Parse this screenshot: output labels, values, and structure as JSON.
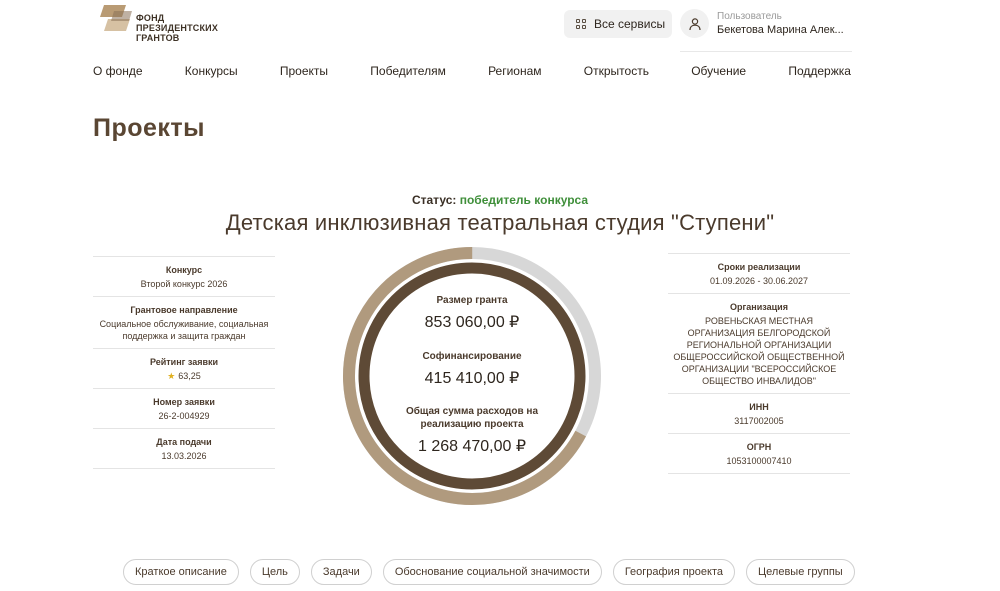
{
  "logo": {
    "line1": "ФОНД",
    "line2": "ПРЕЗИДЕНТСКИХ",
    "line3": "ГРАНТОВ"
  },
  "header": {
    "services_label": "Все сервисы",
    "user_role": "Пользователь",
    "user_name": "Бекетова Марина Алек..."
  },
  "nav": [
    "О фонде",
    "Конкурсы",
    "Проекты",
    "Победителям",
    "Регионам",
    "Открытость",
    "Обучение",
    "Поддержка"
  ],
  "page_title": "Проекты",
  "status": {
    "label": "Статус:",
    "value": "победитель конкурса"
  },
  "project_name": "Детская инклюзивная театральная студия \"Ступени\"",
  "left_info": [
    {
      "label": "Конкурс",
      "value": "Второй конкурс 2026"
    },
    {
      "label": "Грантовое направление",
      "value": "Социальное обслуживание, социальная поддержка и защита граждан"
    },
    {
      "label": "Рейтинг заявки",
      "value": "63,25"
    },
    {
      "label": "Номер заявки",
      "value": "26-2-004929"
    },
    {
      "label": "Дата подачи",
      "value": "13.03.2026"
    }
  ],
  "right_info": [
    {
      "label": "Сроки реализации",
      "value": "01.09.2026 - 30.06.2027"
    },
    {
      "label": "Организация",
      "value": "РОВЕНЬСКАЯ МЕСТНАЯ ОРГАНИЗАЦИЯ БЕЛГОРОДСКОЙ РЕГИОНАЛЬНОЙ ОРГАНИЗАЦИИ ОБЩЕРОССИЙСКОЙ ОБЩЕСТВЕННОЙ ОРГАНИЗАЦИИ \"ВСЕРОССИЙСКОЕ ОБЩЕСТВО ИНВАЛИДОВ\""
    },
    {
      "label": "ИНН",
      "value": "3117002005"
    },
    {
      "label": "ОГРН",
      "value": "1053100007410"
    }
  ],
  "finance": {
    "grant_label": "Размер гранта",
    "grant_value": "853 060,00 ₽",
    "cofin_label": "Софинансирование",
    "cofin_value": "415 410,00 ₽",
    "total_label": "Общая сумма расходов на реализацию проекта",
    "total_value": "1 268 470,00 ₽",
    "grant_share": 0.6725
  },
  "tabs": [
    "Краткое описание",
    "Цель",
    "Задачи",
    "Обоснование социальной значимости",
    "География проекта",
    "Целевые группы"
  ],
  "colors": {
    "brand": "#5a4633",
    "ring_dark": "#5e4a36",
    "ring_light": "#b09a7e",
    "ring_gray": "#d7d7d7",
    "status_green": "#3f8f3a"
  }
}
